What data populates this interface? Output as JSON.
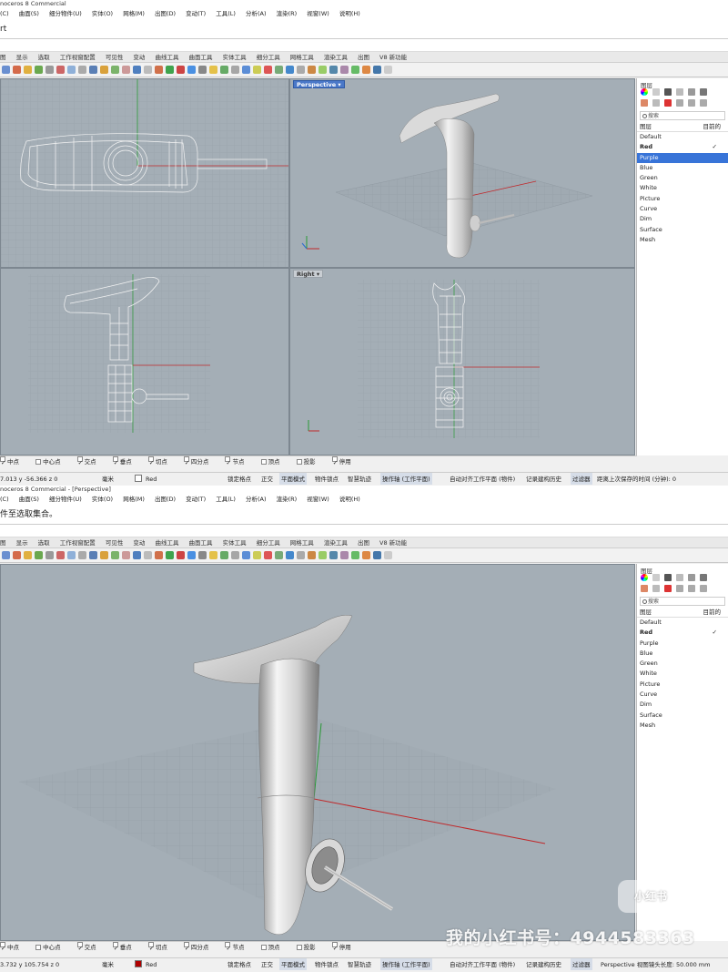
{
  "top": {
    "window_title": "noceros 8 Commercial",
    "menu": [
      "(C)",
      "曲面(S)",
      "细分物件(U)",
      "实体(O)",
      "网格(M)",
      "出图(D)",
      "变动(T)",
      "工具(L)",
      "分析(A)",
      "渲染(R)",
      "视窗(W)",
      "说明(H)"
    ],
    "command_text": "rt",
    "tabs": [
      "图",
      "显示",
      "选取",
      "工作视窗配置",
      "可见性",
      "变动",
      "曲线工具",
      "曲面工具",
      "实体工具",
      "细分工具",
      "网格工具",
      "渲染工具",
      "出图",
      "V8 新功能"
    ],
    "viewport_labels": {
      "perspective": "Perspective",
      "right": "Right"
    },
    "panel": {
      "title": "图层",
      "search_placeholder": "搜索",
      "header_name": "图层",
      "header_current": "目前的",
      "layers": [
        "Default",
        "Red",
        "Purple",
        "Blue",
        "Green",
        "White",
        "Picture",
        "Curve",
        "Dim",
        "Surface",
        "Mesh"
      ],
      "current_layer": "Red",
      "selected_layer": "Purple",
      "checkmark": "✓"
    },
    "osnap": [
      "中点",
      "中心点",
      "交点",
      "垂点",
      "切点",
      "四分点",
      "节点",
      "顶点",
      "投影",
      "停用"
    ],
    "osnap_checked": [
      "中点",
      "交点",
      "垂点",
      "切点",
      "四分点",
      "节点",
      "停用"
    ],
    "status": {
      "coords": "7.013  y -56.366  z 0",
      "units": "毫米",
      "layer": "Red",
      "layer_color": "#ffffff",
      "items": [
        "锁定格点",
        "正交",
        "平面模式",
        "物件锁点",
        "智慧轨迹",
        "操作轴 (工作平面)",
        "自动对齐工作平面 (物件)",
        "记录建构历史",
        "过滤器",
        "距离上次保存的时间 (分钟): 0"
      ]
    }
  },
  "bottom": {
    "window_title": "noceros 8 Commercial - [Perspective]",
    "menu": [
      "(C)",
      "曲面(S)",
      "细分物件(U)",
      "实体(O)",
      "网格(M)",
      "出图(D)",
      "变动(T)",
      "工具(L)",
      "分析(A)",
      "渲染(R)",
      "视窗(W)",
      "说明(H)"
    ],
    "command_text": "件至选取集合。",
    "tabs": [
      "图",
      "显示",
      "选取",
      "工作视窗配置",
      "可见性",
      "变动",
      "曲线工具",
      "曲面工具",
      "实体工具",
      "细分工具",
      "网格工具",
      "渲染工具",
      "出图",
      "V8 新功能"
    ],
    "panel": {
      "title": "图层",
      "search_placeholder": "搜索",
      "header_name": "图层",
      "header_current": "目前的",
      "layers": [
        "Default",
        "Red",
        "Purple",
        "Blue",
        "Green",
        "White",
        "Picture",
        "Curve",
        "Dim",
        "Surface",
        "Mesh"
      ],
      "current_layer": "Red",
      "checkmark": "✓"
    },
    "osnap": [
      "中点",
      "中心点",
      "交点",
      "垂点",
      "切点",
      "四分点",
      "节点",
      "顶点",
      "投影",
      "停用"
    ],
    "osnap_checked": [
      "中点",
      "交点",
      "垂点",
      "切点",
      "四分点",
      "节点",
      "停用"
    ],
    "status": {
      "coords": "3.732  y 105.754  z 0",
      "units": "毫米",
      "layer": "Red",
      "layer_color": "#b00000",
      "items": [
        "锁定格点",
        "正交",
        "平面模式",
        "物件锁点",
        "智慧轨迹",
        "操作轴 (工作平面)",
        "自动对齐工作平面 (物件)",
        "记录建构历史",
        "过滤器",
        "Perspective 视图镜头长度: 50.000 mm"
      ]
    }
  },
  "watermark": "我的小红书号：4944583363",
  "badge": "小红书",
  "colors": {
    "viewport_bg": "#a4aeb6",
    "grid": "#8e98a0",
    "selected_blue": "#3874d8",
    "x_axis": "#c0282a",
    "y_axis": "#2a9a36"
  }
}
